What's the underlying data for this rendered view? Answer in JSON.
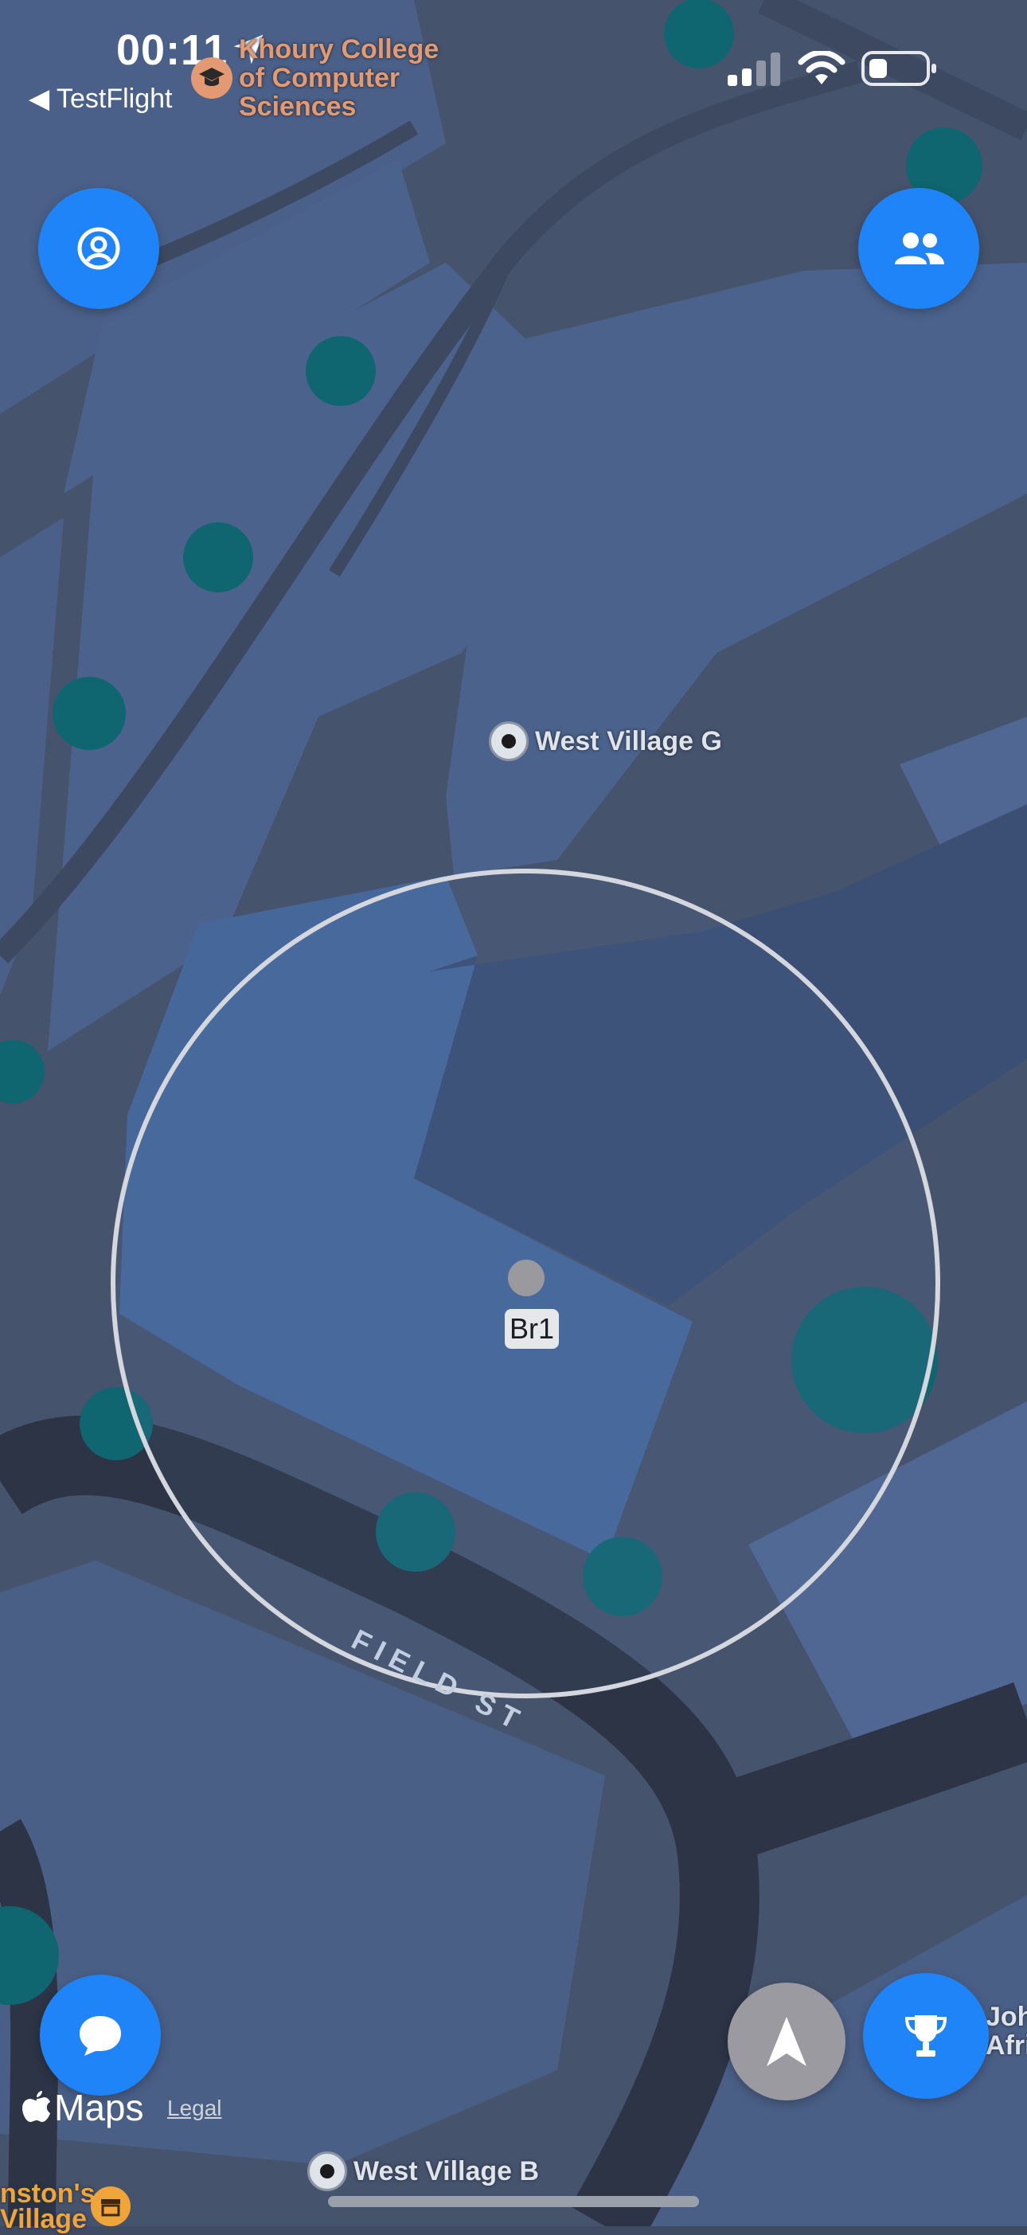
{
  "status_bar": {
    "time": "00:11",
    "back_app": "◀ TestFlight",
    "signal_icon": "signal-bars-icon",
    "wifi_icon": "wifi-icon",
    "battery_icon": "battery-low-icon"
  },
  "map": {
    "school_poi": "Khoury College\nof Computer\nSciences",
    "poi_west_village_g": "West Village G",
    "poi_west_village_b": "West Village B",
    "street_name": "FIELD ST",
    "user_label": "Br1",
    "edge_label_right_top": "Joh",
    "edge_label_right_bottom": "Afric",
    "edge_label_left_top": "nston's",
    "edge_label_left_bottom": "Village"
  },
  "controls": {
    "profile_icon": "person-circle-icon",
    "friends_icon": "two-people-icon",
    "chat_icon": "speech-bubble-icon",
    "location_icon": "navigation-arrow-icon",
    "leaderboard_icon": "trophy-icon"
  },
  "footer": {
    "maps_brand": "Maps",
    "legal_link": "Legal"
  },
  "colors": {
    "accent": "#1f84f7",
    "school_label": "#e39a73",
    "map_background": "#3f4b63"
  }
}
